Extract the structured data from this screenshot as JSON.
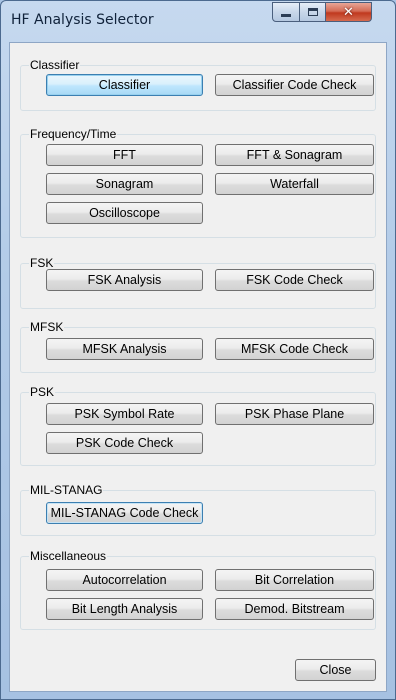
{
  "window": {
    "title": "HF Analysis Selector",
    "controls": [
      "minimize-icon",
      "maximize-icon",
      "close-icon"
    ]
  },
  "groups": {
    "classifier": {
      "label": "Classifier",
      "buttons": [
        "Classifier",
        "Classifier Code Check"
      ]
    },
    "frequency_time": {
      "label": "Frequency/Time",
      "buttons": [
        "FFT",
        "FFT & Sonagram",
        "Sonagram",
        "Waterfall",
        "Oscilloscope"
      ]
    },
    "fsk": {
      "label": "FSK",
      "buttons": [
        "FSK Analysis",
        "FSK Code Check"
      ]
    },
    "mfsk": {
      "label": "MFSK",
      "buttons": [
        "MFSK Analysis",
        "MFSK Code Check"
      ]
    },
    "psk": {
      "label": "PSK",
      "buttons": [
        "PSK Symbol Rate",
        "PSK Phase Plane",
        "PSK Code Check"
      ]
    },
    "milstanag": {
      "label": "MIL-STANAG",
      "buttons": [
        "MIL-STANAG Code Check"
      ]
    },
    "misc": {
      "label": "Miscellaneous",
      "buttons": [
        "Autocorrelation",
        "Bit Correlation",
        "Bit Length Analysis",
        "Demod. Bitstream"
      ]
    }
  },
  "footer": {
    "close_label": "Close"
  }
}
